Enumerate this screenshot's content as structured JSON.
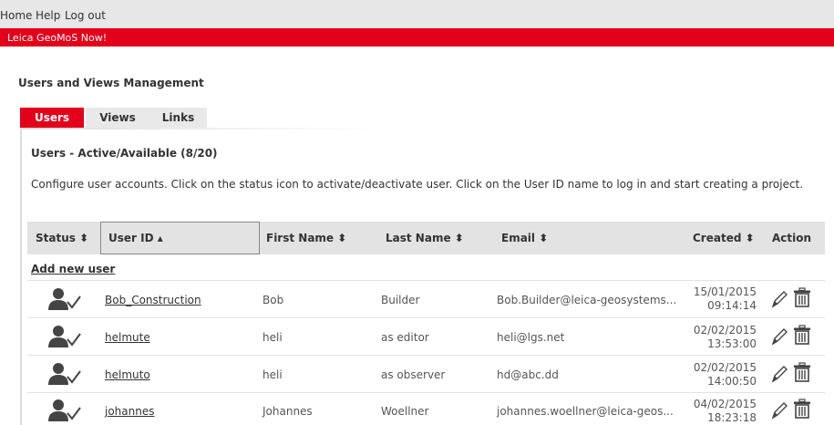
{
  "nav": {
    "home": "Home",
    "help": "Help",
    "logout": "Log out"
  },
  "banner": "Leica GeoMoS Now!",
  "page_title": "Users and Views Management",
  "tabs": [
    {
      "label": "Users"
    },
    {
      "label": "Views"
    },
    {
      "label": "Links"
    }
  ],
  "section_title": "Users - Active/Available (8/20)",
  "description": "Configure user accounts. Click on the status icon to activate/deactivate user. Click on the User ID name to log in and start creating a project.",
  "columns": {
    "status": "Status ⬍",
    "user_id": "User ID ▴",
    "first_name": "First Name ⬍",
    "last_name": "Last Name ⬍",
    "email": "Email ⬍",
    "created": "Created ⬍",
    "action": "Action"
  },
  "add_new_user": "Add new user",
  "accent_color": "#e2001a",
  "icons": {
    "status": "user-active-icon",
    "edit": "pencil-icon",
    "delete": "trash-icon"
  },
  "rows": [
    {
      "user_id": "Bob_Construction",
      "first_name": "Bob",
      "last_name": "Builder",
      "email": "Bob.Builder@leica-geosystems...",
      "created_date": "15/01/2015",
      "created_time": "09:14:14"
    },
    {
      "user_id": "helmute",
      "first_name": "heli",
      "last_name": "as editor",
      "email": "heli@lgs.net",
      "created_date": "02/02/2015",
      "created_time": "13:53:00"
    },
    {
      "user_id": "helmuto",
      "first_name": "heli",
      "last_name": "as observer",
      "email": "hd@abc.dd",
      "created_date": "02/02/2015",
      "created_time": "14:00:50"
    },
    {
      "user_id": "johannes",
      "first_name": "Johannes",
      "last_name": "Woellner",
      "email": "johannes.woellner@leica-geos...",
      "created_date": "04/02/2015",
      "created_time": "18:23:18"
    }
  ]
}
